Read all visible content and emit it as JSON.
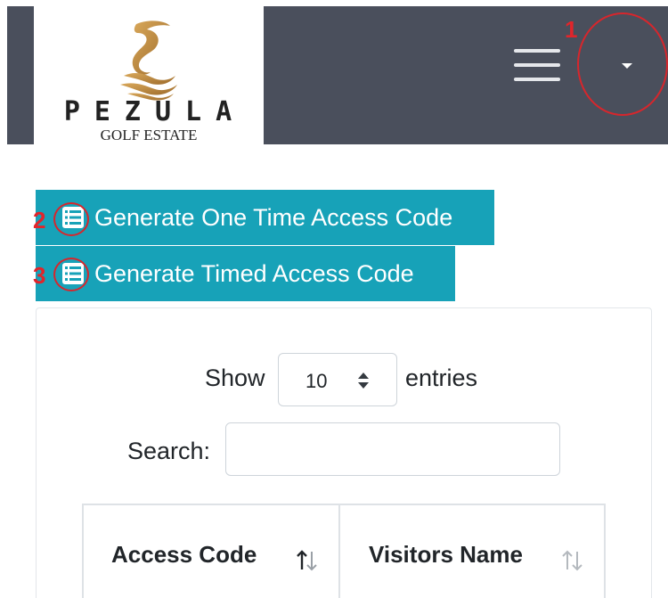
{
  "header": {
    "logo_text": "PEZULA",
    "logo_subtitle": "GOLF ESTATE",
    "menu_icon": "hamburger-icon",
    "dropdown_icon": "caret-down-icon"
  },
  "annotations": [
    "1",
    "2",
    "3"
  ],
  "actions": {
    "one_time_label": "Generate One Time Access Code",
    "timed_label": "Generate Timed Access Code",
    "icon": "list-icon"
  },
  "table_controls": {
    "show_label": "Show",
    "page_size": "10",
    "entries_label": "entries",
    "search_label": "Search:",
    "search_value": ""
  },
  "table": {
    "columns": [
      "Access Code",
      "Visitors Name"
    ]
  },
  "colors": {
    "navbar": "#4a4f5c",
    "button": "#17a2b8",
    "annotation": "#e1252b"
  }
}
